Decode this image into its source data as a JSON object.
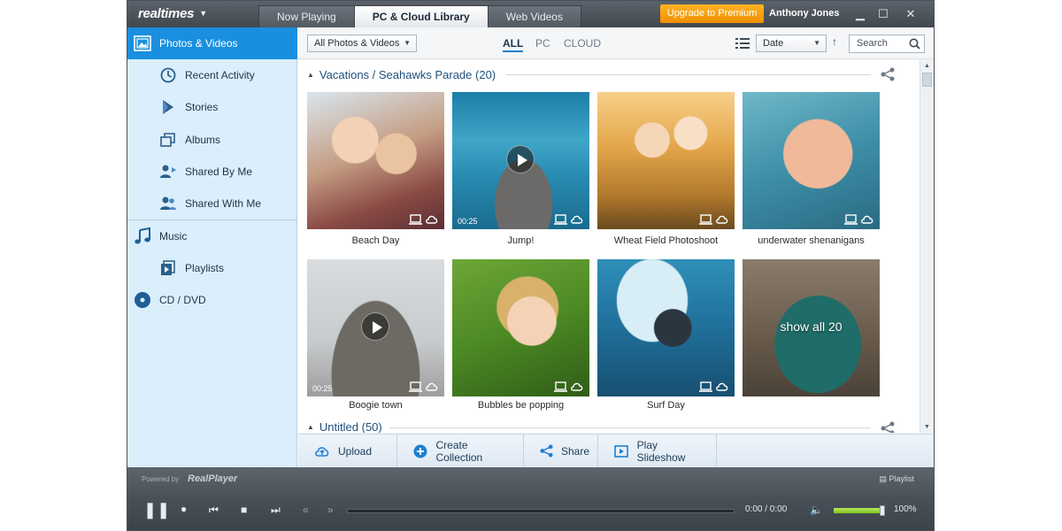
{
  "app": {
    "logo": "realtimes",
    "tabs": [
      {
        "label": "Now Playing"
      },
      {
        "label": "PC & Cloud Library"
      },
      {
        "label": "Web Videos"
      }
    ],
    "premium_label": "Upgrade to Premium",
    "user_name": "Anthony Jones"
  },
  "sidebar": {
    "items": [
      {
        "label": "Photos & Videos"
      },
      {
        "label": "Recent Activity"
      },
      {
        "label": "Stories"
      },
      {
        "label": "Albums"
      },
      {
        "label": "Shared By Me"
      },
      {
        "label": "Shared With Me"
      },
      {
        "label": "Music"
      },
      {
        "label": "Playlists"
      },
      {
        "label": "CD / DVD"
      }
    ]
  },
  "toolbar": {
    "view_filter": "All Photos & Videos",
    "filters": [
      "ALL",
      "PC",
      "CLOUD"
    ],
    "sort_value": "Date",
    "search_placeholder": "Search"
  },
  "groups": [
    {
      "title": "Vacations / Seahawks Parade (20)",
      "items": [
        {
          "caption": "Beach Day",
          "duration": ""
        },
        {
          "caption": "Jump!",
          "duration": "00:25"
        },
        {
          "caption": "Wheat Field Photoshoot",
          "duration": ""
        },
        {
          "caption": "underwater shenanigans",
          "duration": ""
        },
        {
          "caption": "Boogie town",
          "duration": "00:25"
        },
        {
          "caption": "Bubbles be popping",
          "duration": ""
        },
        {
          "caption": "Surf Day",
          "duration": ""
        },
        {
          "caption": "",
          "duration": "",
          "overlay": "show all 20"
        }
      ]
    },
    {
      "title": "Untitled (50)"
    }
  ],
  "actions": [
    {
      "label": "Upload"
    },
    {
      "label": "Create Collection"
    },
    {
      "label": "Share"
    },
    {
      "label": "Play Slideshow"
    }
  ],
  "player": {
    "powered_by": "Powered by",
    "powered_logo": "RealPlayer",
    "playlist_label": "Playlist",
    "time": "0:00 / 0:00",
    "volume_pct": "100%",
    "volume_level": 0.95
  },
  "colors": {
    "accent": "#1a8fe0",
    "premium": "#f5a000",
    "sidebar_bg": "#dbeefc"
  }
}
